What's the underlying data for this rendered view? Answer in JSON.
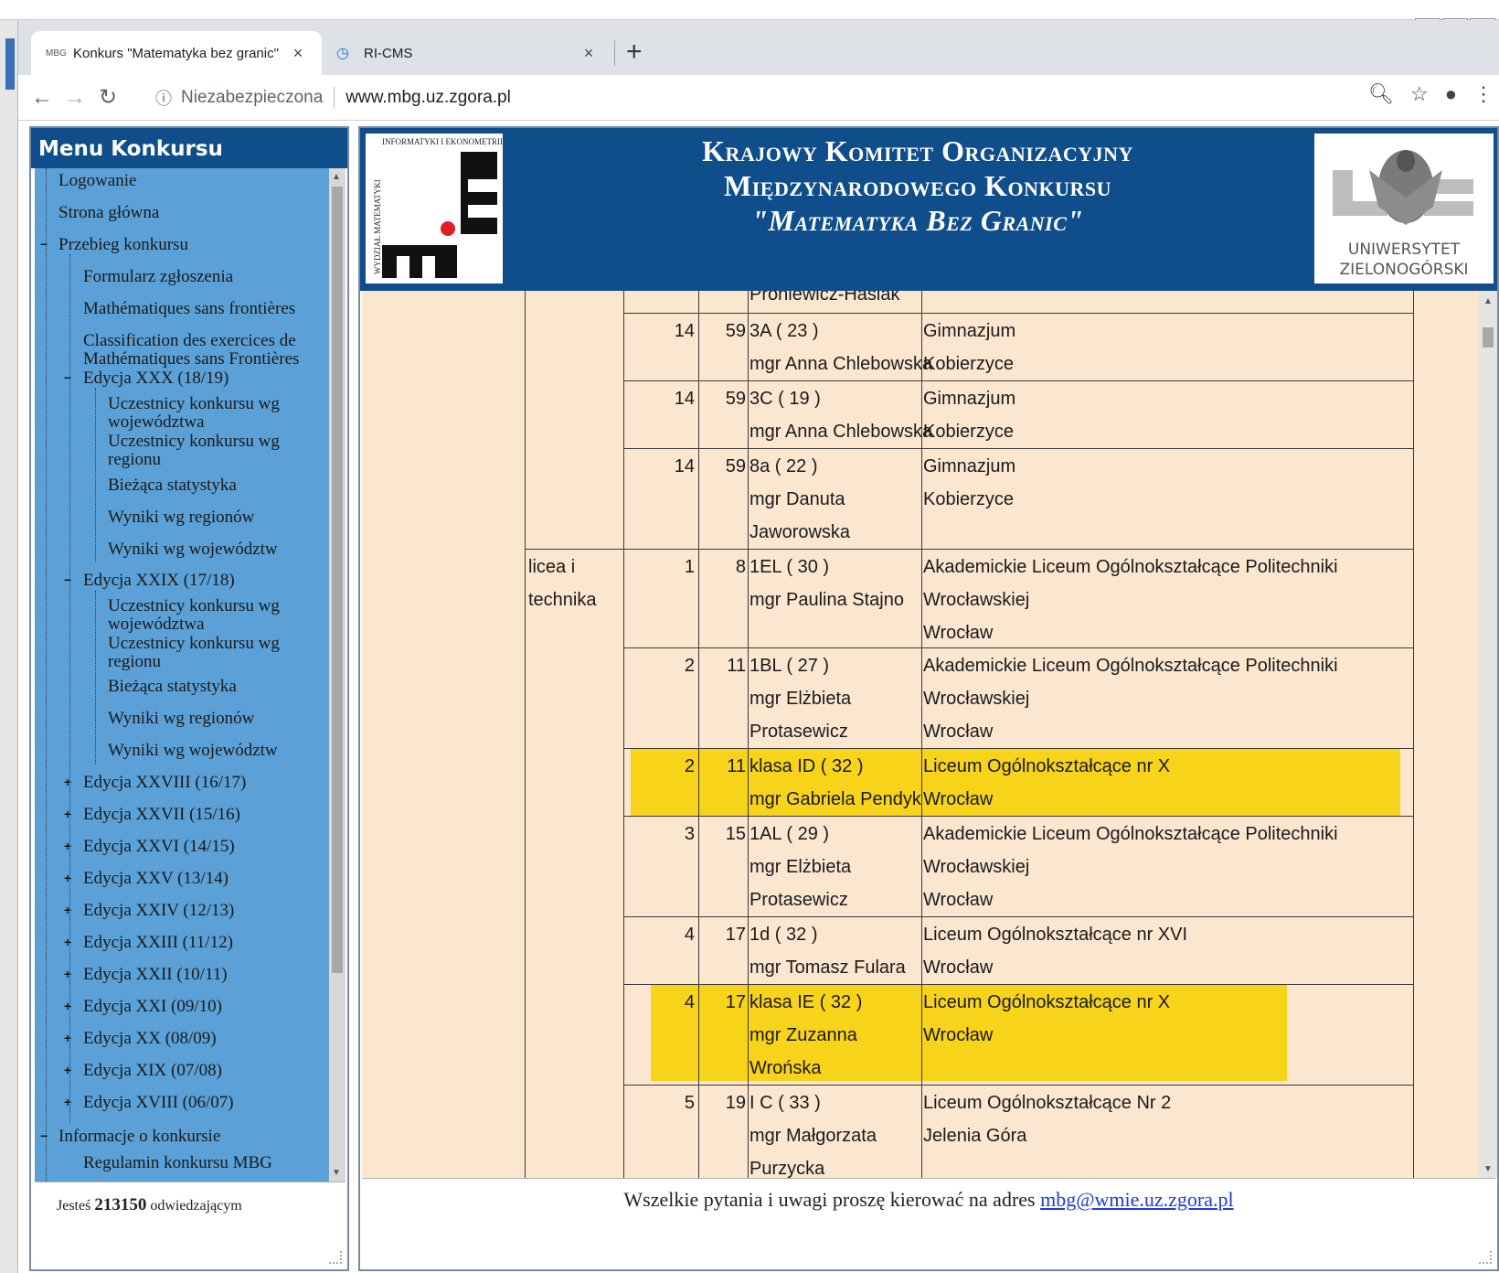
{
  "browser": {
    "tabs": [
      {
        "title": "Konkurs \"Matematyka bez granic\"",
        "active": true,
        "favicon": "MBG"
      },
      {
        "title": "RI-CMS",
        "active": false
      }
    ],
    "security_label": "Niezabezpieczona",
    "url": "www.mbg.uz.zgora.pl",
    "icons": [
      "back-icon",
      "forward-icon",
      "reload-icon",
      "info-icon",
      "zoom-icon",
      "star-icon",
      "account-icon",
      "menu-icon"
    ]
  },
  "sidebar": {
    "title": "Menu Konkursu",
    "items": [
      {
        "label": "Logowanie",
        "toggle": ""
      },
      {
        "label": "Strona główna",
        "toggle": ""
      },
      {
        "label": "Przebieg konkursu",
        "toggle": "−"
      },
      {
        "label": "Formularz zgłoszenia",
        "toggle": ""
      },
      {
        "label": "Mathématiques sans frontières",
        "toggle": ""
      },
      {
        "label": "Classification des exercices de Mathématiques sans Frontières",
        "toggle": ""
      },
      {
        "label": "Edycja XXX (18/19)",
        "toggle": "−"
      },
      {
        "label": "Uczestnicy konkursu wg województwa",
        "toggle": ""
      },
      {
        "label": "Uczestnicy konkursu wg regionu",
        "toggle": ""
      },
      {
        "label": "Bieżąca statystyka",
        "toggle": ""
      },
      {
        "label": "Wyniki wg regionów",
        "toggle": ""
      },
      {
        "label": "Wyniki wg województw",
        "toggle": ""
      },
      {
        "label": "Edycja XXIX (17/18)",
        "toggle": "−"
      },
      {
        "label": "Uczestnicy konkursu wg województwa",
        "toggle": ""
      },
      {
        "label": "Uczestnicy konkursu wg regionu",
        "toggle": ""
      },
      {
        "label": "Bieżąca statystyka",
        "toggle": ""
      },
      {
        "label": "Wyniki wg regionów",
        "toggle": ""
      },
      {
        "label": "Wyniki wg województw",
        "toggle": ""
      },
      {
        "label": "Edycja XXVIII (16/17)",
        "toggle": "+"
      },
      {
        "label": "Edycja XXVII (15/16)",
        "toggle": "+"
      },
      {
        "label": "Edycja XXVI (14/15)",
        "toggle": "+"
      },
      {
        "label": "Edycja XXV (13/14)",
        "toggle": "+"
      },
      {
        "label": "Edycja XXIV (12/13)",
        "toggle": "+"
      },
      {
        "label": "Edycja XXIII (11/12)",
        "toggle": "+"
      },
      {
        "label": "Edycja XXII (10/11)",
        "toggle": "+"
      },
      {
        "label": "Edycja XXI (09/10)",
        "toggle": "+"
      },
      {
        "label": "Edycja XX (08/09)",
        "toggle": "+"
      },
      {
        "label": "Edycja XIX (07/08)",
        "toggle": "+"
      },
      {
        "label": "Edycja XVIII (06/07)",
        "toggle": "+"
      },
      {
        "label": "Informacje o konkursie",
        "toggle": "−"
      },
      {
        "label": "Regulamin konkursu MBG",
        "toggle": ""
      }
    ],
    "visits_prefix": "Jesteś",
    "visits_count": "213150",
    "visits_suffix": "odwiedzającym"
  },
  "banner": {
    "line1": "Krajowy Komitet Organizacyjny",
    "line2": "Międzynarodowego Konkursu",
    "line3": "\"Matematyka Bez Granic\"",
    "logo_left_top": "INFORMATYKI I EKONOMETRII",
    "logo_left_side": "WYDZIAŁ MATEMATYKI",
    "logo_right_text1": "UNIWERSYTET",
    "logo_right_text2": "ZIELONOGÓRSKI"
  },
  "table": {
    "category_label_1": "licea i",
    "category_label_2": "technika",
    "rows": [
      {
        "place": "",
        "points": "",
        "lines_class": [
          "Proniewicz-Hasiak"
        ],
        "lines_school": [],
        "highlight": false
      },
      {
        "place": "14",
        "points": "59",
        "lines_class": [
          "3A ( 23 )",
          "mgr Anna Chlebowska"
        ],
        "lines_school": [
          "Gimnazjum",
          "Kobierzyce"
        ],
        "highlight": false
      },
      {
        "place": "14",
        "points": "59",
        "lines_class": [
          "3C ( 19 )",
          "mgr Anna Chlebowska"
        ],
        "lines_school": [
          "Gimnazjum",
          "Kobierzyce"
        ],
        "highlight": false
      },
      {
        "place": "14",
        "points": "59",
        "lines_class": [
          "8a ( 22 )",
          "mgr Danuta",
          "Jaworowska"
        ],
        "lines_school": [
          "Gimnazjum",
          "Kobierzyce"
        ],
        "highlight": false
      },
      {
        "place": "1",
        "points": "8",
        "lines_class": [
          "1EL ( 30 )",
          "mgr Paulina Stajno"
        ],
        "lines_school": [
          "Akademickie Liceum Ogólnokształcące Politechniki",
          "Wrocławskiej",
          "Wrocław"
        ],
        "highlight": false
      },
      {
        "place": "2",
        "points": "11",
        "lines_class": [
          "1BL ( 27 )",
          "mgr Elżbieta",
          "Protasewicz"
        ],
        "lines_school": [
          "Akademickie Liceum Ogólnokształcące Politechniki",
          "Wrocławskiej",
          "Wrocław"
        ],
        "highlight": false
      },
      {
        "place": "2",
        "points": "11",
        "lines_class": [
          "klasa ID ( 32 )",
          "mgr Gabriela Pendyk"
        ],
        "lines_school": [
          "Liceum Ogólnokształcące nr X",
          "Wrocław"
        ],
        "highlight": true
      },
      {
        "place": "3",
        "points": "15",
        "lines_class": [
          "1AL ( 29 )",
          "mgr Elżbieta",
          "Protasewicz"
        ],
        "lines_school": [
          "Akademickie Liceum Ogólnokształcące Politechniki",
          "Wrocławskiej",
          "Wrocław"
        ],
        "highlight": false
      },
      {
        "place": "4",
        "points": "17",
        "lines_class": [
          "1d ( 32 )",
          "mgr Tomasz Fulara"
        ],
        "lines_school": [
          "Liceum Ogólnokształcące nr XVI",
          "Wrocław"
        ],
        "highlight": false
      },
      {
        "place": "4",
        "points": "17",
        "lines_class": [
          "klasa IE ( 32 )",
          "mgr Zuzanna",
          "Wrońska"
        ],
        "lines_school": [
          "Liceum Ogólnokształcące nr X",
          "Wrocław"
        ],
        "highlight": true
      },
      {
        "place": "5",
        "points": "19",
        "lines_class": [
          "I C ( 33 )",
          "mgr Małgorzata",
          "Purzycka"
        ],
        "lines_school": [
          "Liceum Ogólnokształcące Nr 2",
          "Jelenia Góra"
        ],
        "highlight": false
      }
    ]
  },
  "footer": {
    "message": "Wszelkie pytania i uwagi proszę kierować na adres",
    "email": "mbg@wmie.uz.zgora.pl"
  },
  "colors": {
    "banner": "#0f4e8a",
    "sidebar": "#5ba0d6",
    "content_bg": "#fbe7d0",
    "highlight": "#f7d31a",
    "link": "#1b3bd6"
  }
}
